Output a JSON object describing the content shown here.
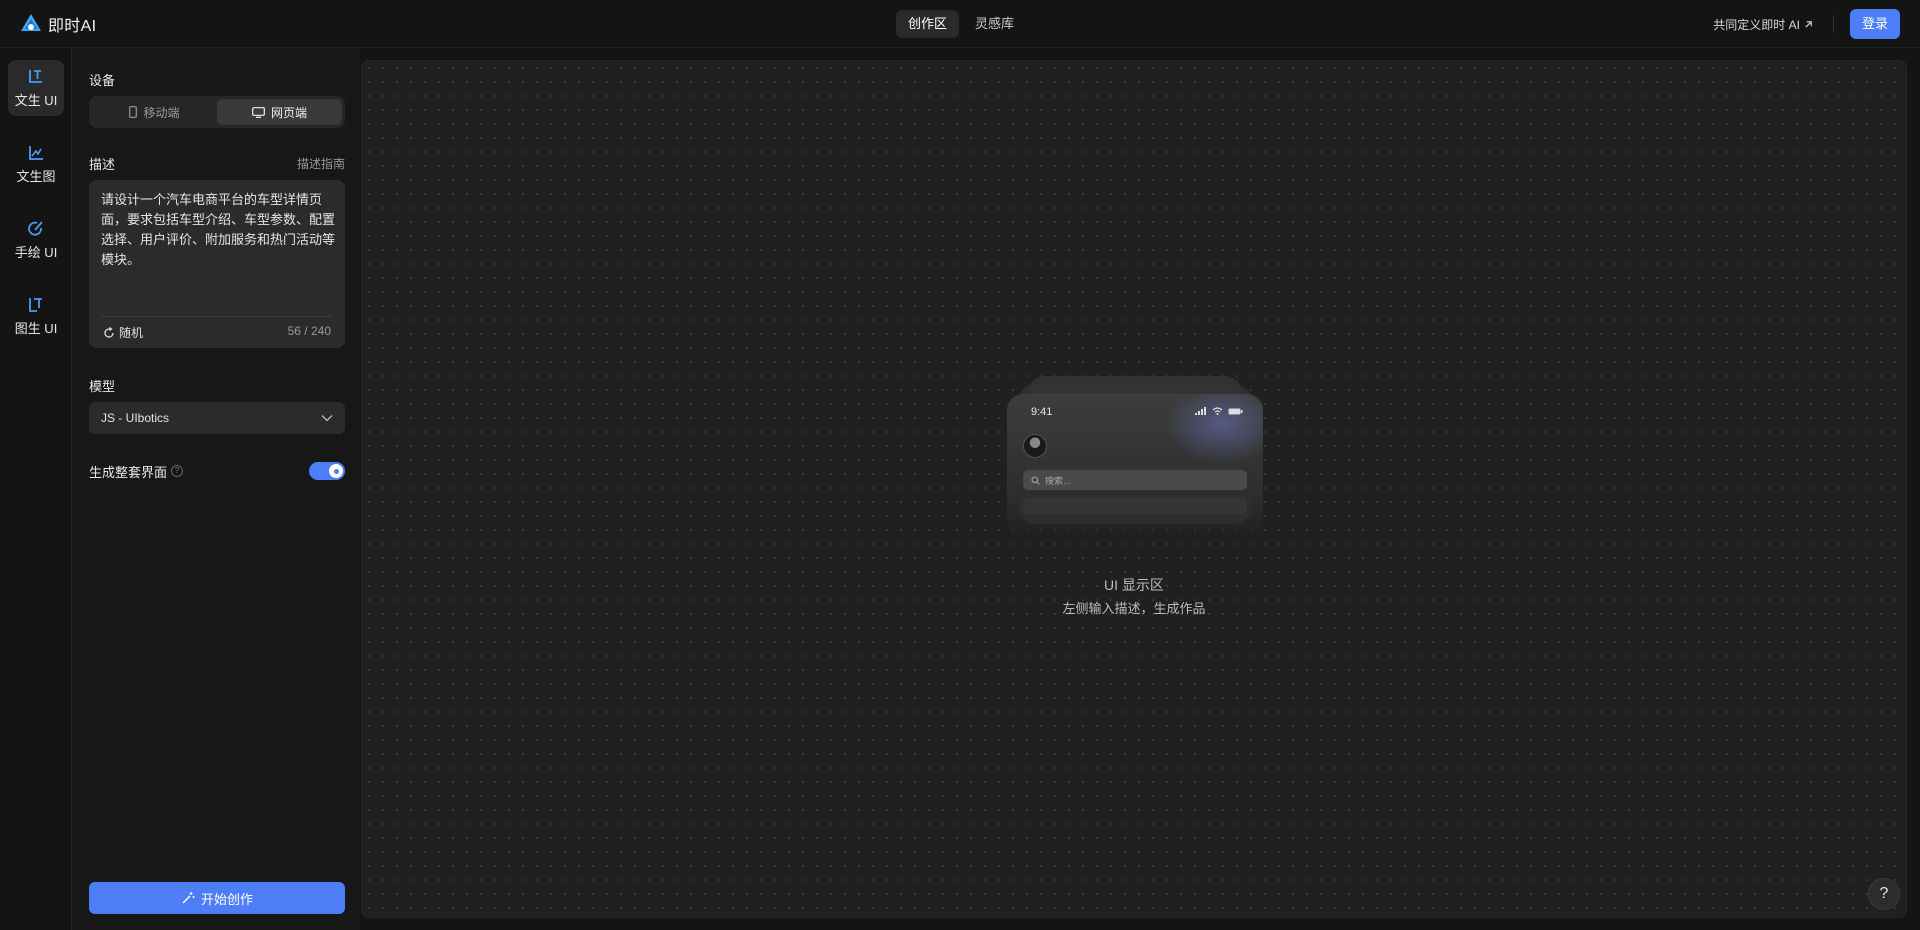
{
  "header": {
    "logo_text": "即时AI",
    "tabs": [
      {
        "label": "创作区",
        "active": true
      },
      {
        "label": "灵感库",
        "active": false
      }
    ],
    "co_link": "共同定义即时 AI",
    "login_label": "登录"
  },
  "rail": {
    "items": [
      {
        "label": "文生 UI",
        "icon": "text-to-ui-icon",
        "active": true
      },
      {
        "label": "文生图",
        "icon": "text-to-image-icon",
        "active": false
      },
      {
        "label": "手绘 UI",
        "icon": "sketch-ui-icon",
        "active": false
      },
      {
        "label": "图生 UI",
        "icon": "image-to-ui-icon",
        "active": false
      }
    ]
  },
  "panel": {
    "device_label": "设备",
    "device_options": [
      {
        "label": "移动端",
        "icon": "mobile-icon",
        "active": false
      },
      {
        "label": "网页端",
        "icon": "desktop-icon",
        "active": true
      }
    ],
    "desc_label": "描述",
    "desc_guide": "描述指南",
    "desc_text": "请设计一个汽车电商平台的车型详情页面，要求包括车型介绍、车型参数、配置选择、用户评价、附加服务和热门活动等模块。",
    "random_label": "随机",
    "counter": "56 / 240",
    "model_label": "模型",
    "model_value": "JS - UIbotics",
    "full_label": "生成整套界面",
    "full_enabled": true,
    "start_label": "开始创作"
  },
  "canvas": {
    "phone_time": "9:41",
    "phone_search_placeholder": "搜索...",
    "title": "UI 显示区",
    "subtitle": "左侧输入描述，生成作品",
    "help_label": "?"
  },
  "colors": {
    "accent": "#4d7ef7",
    "background": "#141414",
    "canvas": "#202020"
  }
}
